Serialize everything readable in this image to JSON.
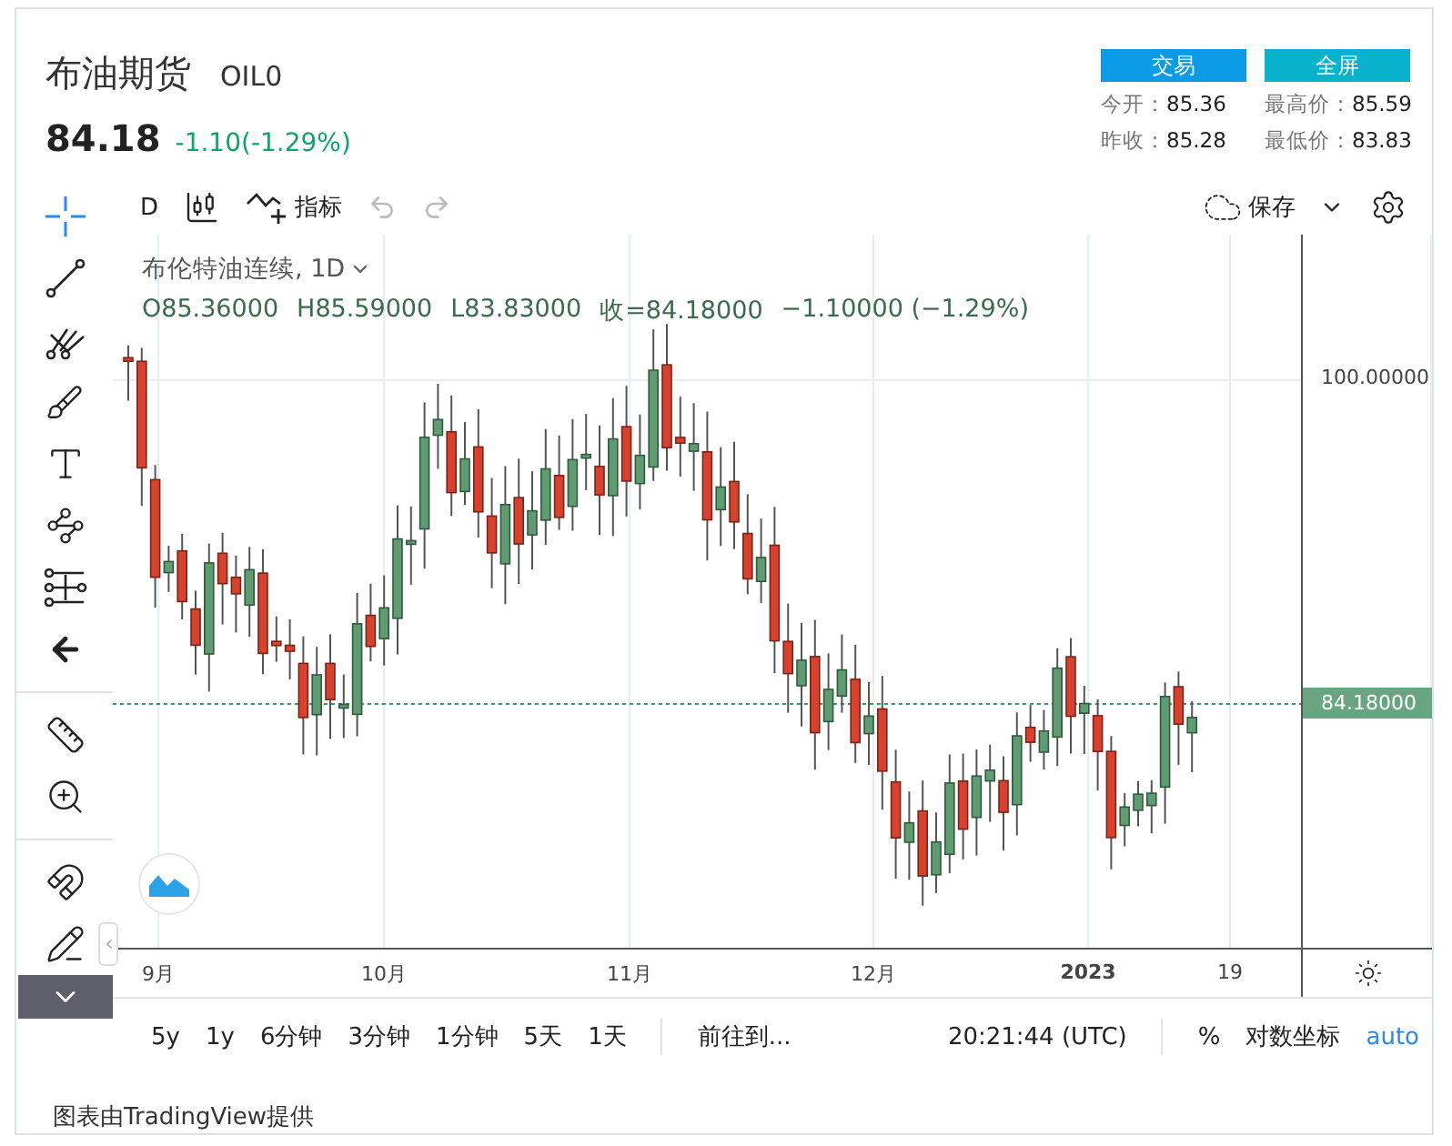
{
  "header": {
    "title": "布油期货",
    "symbol": "OIL0",
    "price": "84.18",
    "change": "-1.10(-1.29%)"
  },
  "actions": [
    {
      "label": "交易",
      "color": "#0b9be6"
    },
    {
      "label": "全屏",
      "color": "#08b2cc"
    }
  ],
  "stats": [
    {
      "label": "今开：",
      "value": "85.36"
    },
    {
      "label": "最高价：",
      "value": "85.59"
    },
    {
      "label": "昨收：",
      "value": "85.28"
    },
    {
      "label": "最低价：",
      "value": "83.83"
    }
  ],
  "toolbar": {
    "interval": "D",
    "indicators": "指标",
    "save": "保存"
  },
  "chart": {
    "legend_title": "布伦特油连续, 1D",
    "ohlc": [
      "O85.36000",
      "H85.59000",
      "L83.83000",
      "收=84.18000",
      "−1.10000 (−1.29%)"
    ],
    "y_tick": "100.00000",
    "last_price": "84.18000",
    "x_labels": [
      {
        "label": "9月",
        "kind": "month"
      },
      {
        "label": "10月",
        "kind": "month"
      },
      {
        "label": "11月",
        "kind": "month"
      },
      {
        "label": "12月",
        "kind": "month"
      },
      {
        "label": "2023",
        "kind": "year"
      },
      {
        "label": "19",
        "kind": "day"
      }
    ]
  },
  "bottom_bar": {
    "ranges": [
      "5y",
      "1y",
      "6分钟",
      "3分钟",
      "1分钟",
      "5天",
      "1天"
    ],
    "goto": "前往到...",
    "time": "20:21:44 (UTC)",
    "percent": "%",
    "log": "对数坐标",
    "auto": "auto"
  },
  "footer": "图表由TradingView提供"
}
